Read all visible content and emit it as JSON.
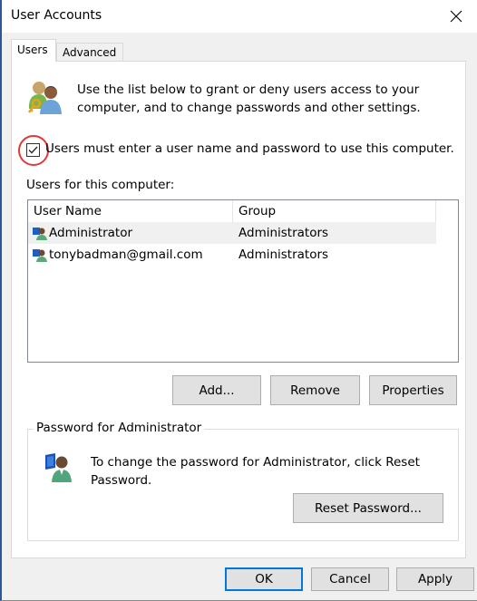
{
  "window": {
    "title": "User Accounts",
    "close_icon": "close-icon"
  },
  "tabs": [
    {
      "label": "Users",
      "active": true
    },
    {
      "label": "Advanced",
      "active": false
    }
  ],
  "users_tab": {
    "intro_icon": "users-key-icon",
    "intro_text": "Use the list below to grant or deny users access to your computer, and to change passwords and other settings.",
    "require_login": {
      "label": "Users must enter a user name and password to use this computer.",
      "checked": true,
      "highlighted": true,
      "highlight_color": "#e2383a"
    },
    "list_label": "Users for this computer:",
    "list": {
      "columns": [
        "User Name",
        "Group"
      ],
      "rows": [
        {
          "icon": "user-icon",
          "name": "Administrator",
          "group": "Administrators",
          "selected": true
        },
        {
          "icon": "user-icon",
          "name": "tonybadman@gmail.com",
          "group": "Administrators",
          "selected": false
        }
      ]
    },
    "buttons": {
      "add": "Add...",
      "remove": "Remove",
      "properties": "Properties"
    },
    "password_group": {
      "legend": "Password for Administrator",
      "icon": "user-computer-icon",
      "text": "To change the password for Administrator, click Reset Password.",
      "reset_button": "Reset Password..."
    }
  },
  "footer": {
    "ok": "OK",
    "cancel": "Cancel",
    "apply": "Apply",
    "focus_color": "#0078d7"
  }
}
